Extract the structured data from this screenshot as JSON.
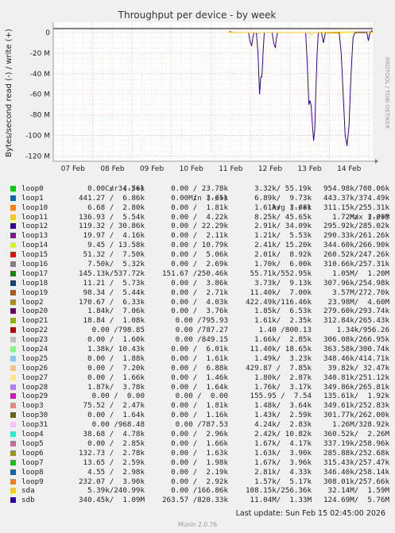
{
  "chart_data": {
    "type": "line",
    "title": "Throughput per device - by week",
    "ylabel": "Bytes/second read (-) / write (+)",
    "vertical_label": "RRDTOOL / TOBI OETIKER",
    "ylim": [
      -125000000,
      10000000
    ],
    "y_ticks": [
      {
        "value": 0,
        "label": "0"
      },
      {
        "value": -20000000,
        "label": "-20 M"
      },
      {
        "value": -40000000,
        "label": "-40 M"
      },
      {
        "value": -60000000,
        "label": "-60 M"
      },
      {
        "value": -80000000,
        "label": "-80 M"
      },
      {
        "value": -100000000,
        "label": "-100 M"
      },
      {
        "value": -120000000,
        "label": "-120 M"
      }
    ],
    "xlim": [
      0,
      8.1
    ],
    "x_ticks": [
      {
        "value": 0.5,
        "label": "07 Feb"
      },
      {
        "value": 1.5,
        "label": "08 Feb"
      },
      {
        "value": 2.5,
        "label": "09 Feb"
      },
      {
        "value": 3.5,
        "label": "10 Feb"
      },
      {
        "value": 4.5,
        "label": "11 Feb"
      },
      {
        "value": 5.5,
        "label": "12 Feb"
      },
      {
        "value": 6.5,
        "label": "13 Feb"
      },
      {
        "value": 7.5,
        "label": "14 Feb"
      }
    ],
    "series": [
      {
        "name": "sdb",
        "color": "#330099",
        "points": [
          [
            4.45,
            0
          ],
          [
            4.48,
            1000000
          ],
          [
            4.55,
            0
          ],
          [
            4.95,
            0
          ],
          [
            4.99,
            -9000000
          ],
          [
            5.03,
            -13000000
          ],
          [
            5.06,
            -5000000
          ],
          [
            5.09,
            0
          ],
          [
            5.15,
            0
          ],
          [
            5.19,
            -20000000
          ],
          [
            5.23,
            -60000000
          ],
          [
            5.26,
            -43000000
          ],
          [
            5.29,
            -43000000
          ],
          [
            5.32,
            -20000000
          ],
          [
            5.35,
            0
          ],
          [
            5.55,
            0
          ],
          [
            5.59,
            -10000000
          ],
          [
            5.63,
            -15000000
          ],
          [
            5.66,
            -5000000
          ],
          [
            5.69,
            0
          ],
          [
            6.4,
            0
          ],
          [
            6.44,
            -30000000
          ],
          [
            6.48,
            -70000000
          ],
          [
            6.51,
            -66000000
          ],
          [
            6.54,
            -72000000
          ],
          [
            6.57,
            -90000000
          ],
          [
            6.6,
            -105000000
          ],
          [
            6.63,
            -95000000
          ],
          [
            6.66,
            -55000000
          ],
          [
            6.69,
            -20000000
          ],
          [
            6.72,
            0
          ],
          [
            6.8,
            0
          ],
          [
            6.85,
            -10000000
          ],
          [
            6.9,
            0
          ],
          [
            7.25,
            0
          ],
          [
            7.3,
            -20000000
          ],
          [
            7.35,
            -60000000
          ],
          [
            7.4,
            -100000000
          ],
          [
            7.45,
            -110000000
          ],
          [
            7.5,
            -90000000
          ],
          [
            7.55,
            -40000000
          ],
          [
            7.6,
            -5000000
          ],
          [
            7.65,
            0
          ],
          [
            7.95,
            0
          ],
          [
            7.99,
            -8000000
          ],
          [
            8.03,
            0
          ],
          [
            8.07,
            2000000
          ],
          [
            8.1,
            0
          ]
        ]
      },
      {
        "name": "sda",
        "color": "#FFCC00",
        "points": [
          [
            4.45,
            0
          ],
          [
            4.48,
            500000
          ],
          [
            4.55,
            0
          ],
          [
            5.15,
            0
          ],
          [
            5.2,
            -1000000
          ],
          [
            5.25,
            0
          ],
          [
            6.5,
            0
          ],
          [
            6.55,
            -1500000
          ],
          [
            6.6,
            0
          ],
          [
            8.05,
            1000000
          ],
          [
            8.1,
            0
          ]
        ]
      }
    ],
    "legend_columns": [
      "Cur (-/+)",
      "Min (-/+)",
      "Avg (-/+)",
      "Max (-/+)"
    ],
    "legend": [
      {
        "name": "loop0",
        "color": "#00CC00",
        "cur": "0.00 / 34.56k",
        "min": "0.00 / 23.78k",
        "avg": "3.32k/ 55.19k",
        "max": "954.98k/708.06k"
      },
      {
        "name": "loop1",
        "color": "#0066B3",
        "cur": "441.27 /  6.86k",
        "min": "0.00 /  3.65k",
        "avg": "6.89k/  9.73k",
        "max": "443.37k/374.49k"
      },
      {
        "name": "loop10",
        "color": "#FF8000",
        "cur": "6.68 /  2.80k",
        "min": "0.00 /  1.81k",
        "avg": "1.61k/  3.68k",
        "max": "311.15k/255.31k"
      },
      {
        "name": "loop11",
        "color": "#FFCC00",
        "cur": "136.93 /  5.54k",
        "min": "0.00 /  4.22k",
        "avg": "8.25k/ 45.65k",
        "max": "1.72M/  3.09M"
      },
      {
        "name": "loop12",
        "color": "#330099",
        "cur": "119.32 / 30.86k",
        "min": "0.00 / 22.29k",
        "avg": "2.91k/ 34.09k",
        "max": "295.92k/285.02k"
      },
      {
        "name": "loop13",
        "color": "#990099",
        "cur": "19.97 /  4.16k",
        "min": "0.00 /  2.11k",
        "avg": "1.21k/  5.53k",
        "max": "290.33k/261.26k"
      },
      {
        "name": "loop14",
        "color": "#CCFF00",
        "cur": "9.45 / 13.58k",
        "min": "0.00 / 10.79k",
        "avg": "2.41k/ 15.20k",
        "max": "344.60k/266.90k"
      },
      {
        "name": "loop15",
        "color": "#FF0000",
        "cur": "51.32 /  7.50k",
        "min": "0.00 /  5.06k",
        "avg": "2.01k/  8.92k",
        "max": "260.52k/247.26k"
      },
      {
        "name": "loop16",
        "color": "#808080",
        "cur": "7.50k/  5.32k",
        "min": "0.00 /  2.69k",
        "avg": "1.70k/  6.00k",
        "max": "310.66k/257.31k"
      },
      {
        "name": "loop17",
        "color": "#008F00",
        "cur": "145.13k/537.72k",
        "min": "151.67 /250.46k",
        "avg": "55.71k/552.95k",
        "max": "1.05M/  1.20M"
      },
      {
        "name": "loop18",
        "color": "#00487D",
        "cur": "11.21 /  5.73k",
        "min": "0.00 /  3.86k",
        "avg": "3.73k/  9.13k",
        "max": "307.96k/254.98k"
      },
      {
        "name": "loop19",
        "color": "#B35A00",
        "cur": "98.34 /  5.44k",
        "min": "0.00 /  2.71k",
        "avg": "11.40k/  7.00k",
        "max": "3.57M/272.70k"
      },
      {
        "name": "loop2",
        "color": "#B38F00",
        "cur": "170.67 /  6.33k",
        "min": "0.00 /  4.03k",
        "avg": "422.49k/116.46k",
        "max": "23.98M/  4.60M"
      },
      {
        "name": "loop20",
        "color": "#6B006B",
        "cur": "1.84k/  7.06k",
        "min": "0.00 /  3.76k",
        "avg": "1.85k/  6.53k",
        "max": "279.60k/293.74k"
      },
      {
        "name": "loop21",
        "color": "#8FB300",
        "cur": "18.84 /  1.08k",
        "min": "0.00 /795.93",
        "avg": "1.61k/  2.35k",
        "max": "312.84k/265.43k"
      },
      {
        "name": "loop22",
        "color": "#B30000",
        "cur": "0.00 /798.85",
        "min": "0.00 /787.27",
        "avg": "1.40 /800.13",
        "max": "1.34k/956.26"
      },
      {
        "name": "loop23",
        "color": "#BEBEBE",
        "cur": "0.00 /  1.60k",
        "min": "0.00 /849.15",
        "avg": "1.66k/  2.85k",
        "max": "306.08k/266.95k"
      },
      {
        "name": "loop24",
        "color": "#80FF80",
        "cur": "1.38k/ 10.43k",
        "min": "0.00 /  6.01k",
        "avg": "11.40k/ 18.65k",
        "max": "363.58k/300.74k"
      },
      {
        "name": "loop25",
        "color": "#80C9FF",
        "cur": "0.00 /  1.88k",
        "min": "0.00 /  1.61k",
        "avg": "1.49k/  3.23k",
        "max": "348.46k/414.71k"
      },
      {
        "name": "loop26",
        "color": "#FFC080",
        "cur": "0.00 /  7.20k",
        "min": "0.00 /  6.88k",
        "avg": "429.87 /  7.85k",
        "max": "39.82k/ 32.47k"
      },
      {
        "name": "loop27",
        "color": "#FFE680",
        "cur": "0.00 /  1.66k",
        "min": "0.00 /  1.46k",
        "avg": "1.80k/  2.87k",
        "max": "340.81k/251.12k"
      },
      {
        "name": "loop28",
        "color": "#AA80FF",
        "cur": "1.87k/  3.78k",
        "min": "0.00 /  1.64k",
        "avg": "1.76k/  3.17k",
        "max": "349.86k/265.81k"
      },
      {
        "name": "loop29",
        "color": "#EE00CC",
        "cur": "0.00 /  0.00",
        "min": "0.00 /  0.00",
        "avg": "155.95 /  7.54",
        "max": "135.61k/  1.92k"
      },
      {
        "name": "loop3",
        "color": "#FF8080",
        "cur": "75.52 /  2.47k",
        "min": "0.00 /  1.81k",
        "avg": "1.48k/  3.64k",
        "max": "349.61k/252.83k"
      },
      {
        "name": "loop30",
        "color": "#666600",
        "cur": "0.00 /  1.64k",
        "min": "0.00 /  1.16k",
        "avg": "1.43k/  2.59k",
        "max": "301.77k/262.00k"
      },
      {
        "name": "loop31",
        "color": "#FFBFFF",
        "cur": "0.00 /968.48",
        "min": "0.00 /787.53",
        "avg": "4.24k/  2.83k",
        "max": "1.26M/328.92k"
      },
      {
        "name": "loop4",
        "color": "#00FFCC",
        "cur": "38.68 /  4.78k",
        "min": "0.00 /  2.96k",
        "avg": "2.42k/ 10.82k",
        "max": "360.52k/  2.26M"
      },
      {
        "name": "loop5",
        "color": "#CC6699",
        "cur": "0.00 /  2.85k",
        "min": "0.00 /  1.66k",
        "avg": "1.67k/  4.17k",
        "max": "337.19k/258.96k"
      },
      {
        "name": "loop6",
        "color": "#999900",
        "cur": "132.73 /  2.78k",
        "min": "0.00 /  1.63k",
        "avg": "1.63k/  3.90k",
        "max": "285.88k/252.68k"
      },
      {
        "name": "loop7",
        "color": "#00CC00",
        "cur": "13.65 /  2.59k",
        "min": "0.00 /  1.98k",
        "avg": "1.67k/  3.96k",
        "max": "315.43k/257.47k"
      },
      {
        "name": "loop8",
        "color": "#0066B3",
        "cur": "4.55 /  2.98k",
        "min": "0.00 /  2.19k",
        "avg": "2.81k/  4.33k",
        "max": "346.40k/258.14k"
      },
      {
        "name": "loop9",
        "color": "#FF8000",
        "cur": "232.07 /  3.90k",
        "min": "0.00 /  2.92k",
        "avg": "1.57k/  5.17k",
        "max": "308.01k/257.66k"
      },
      {
        "name": "sda",
        "color": "#FFCC00",
        "cur": "5.39k/240.99k",
        "min": "0.00 /166.86k",
        "avg": "108.15k/256.36k",
        "max": "32.14M/  1.59M"
      },
      {
        "name": "sdb",
        "color": "#330099",
        "cur": "340.45k/  1.09M",
        "min": "263.57 /820.33k",
        "avg": "11.04M/  1.33M",
        "max": "124.69M/  5.76M"
      }
    ]
  },
  "footer": {
    "last_update": "Last update: Sun Feb 15 02:45:00 2026",
    "munin": "Munin 2.0.76"
  }
}
